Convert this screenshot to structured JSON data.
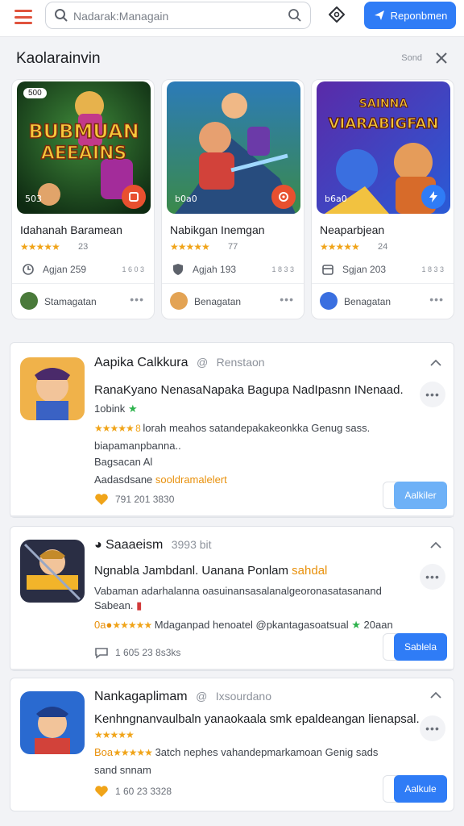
{
  "topbar": {
    "search_placeholder": "Nadarak:Managain",
    "primary_button": "Reponbmen",
    "accent": "#2f7cf6",
    "menu_color": "#e0533d"
  },
  "section": {
    "title": "Kaolarainvin",
    "sub": "Sond"
  },
  "cards": [
    {
      "thumb_text_1": "BUBMUAN",
      "thumb_text_2": "AEEAINS",
      "top_tag": "500",
      "tag": "503",
      "title": "Idahanah Baramean",
      "stars": "★★★★★",
      "rating": "23",
      "meta": "Agjan 259",
      "count": "1 6 0 3",
      "author": "Stamagatan",
      "more": "•••"
    },
    {
      "tag": "b0a0",
      "title": "Nabikgan Inemgan",
      "stars": "★★★★★",
      "rating": "77",
      "meta": "Agjah 193",
      "count": "1 8 3 3",
      "author": "Benagatan",
      "more": "•••"
    },
    {
      "thumb_text_1": "SAINNA",
      "thumb_text_2": "VIARABIGFAN",
      "tag": "b6a0",
      "title": "Neaparbjean",
      "stars": "★★★★★",
      "rating": "24",
      "meta": "Sgjan 203",
      "count": "1 8 3 3",
      "author": "Benagatan",
      "more": "•••"
    }
  ],
  "posts": [
    {
      "head": "Aapika Calkkura",
      "handle": "Renstaon",
      "line1": "RanaKyano NenasaNapaka Bagupa NadIpasnn INenaad.",
      "line2_pre": "1obink",
      "line3_stars": "★★★★★ 8",
      "line3": "lorah meahos satandepakakeonkka Genug sass.",
      "line4": "biapamanpbanna..",
      "line5": "Bagsacan Al",
      "line6_pre": "Aadasdsane",
      "line6_hl": "sooldramalelert",
      "foot": "791 201 3830",
      "action": "Aalkiler",
      "more": "•••"
    },
    {
      "head": "Saaaeism",
      "handle": "3993 bit",
      "line1_pre": "Ngnabla Jambdanl. Uanana Ponlam",
      "line1_hl": "sahdal",
      "line2": "Vabaman adarhalanna oasuinansasalanalgeoronasatasanand",
      "line3": "Sabean.",
      "line4_pre": "0a●",
      "line4_stars": "★★★★★",
      "line4": "Mdaganpad henoatel @pkantagasoatsual",
      "line4_post": "20aan",
      "foot": "1 605 23 8s3ks",
      "action": "Sablela",
      "more": "•••"
    },
    {
      "head": "Nankagaplimam",
      "handle": "Ixsourdano",
      "line1": "Kenhngnanvaulbaln yanaokaala smk epaldeangan lienapsal.",
      "line2_stars": "★★★★★",
      "line3_pre": "Boa",
      "line3_stars": "★★★★★",
      "line3": "3atch nephes vahandepmarkamoan Genig sads",
      "line4": "sand snnam",
      "foot": "1 60 23 3328",
      "action": "Aalkule",
      "more": "•••"
    }
  ]
}
